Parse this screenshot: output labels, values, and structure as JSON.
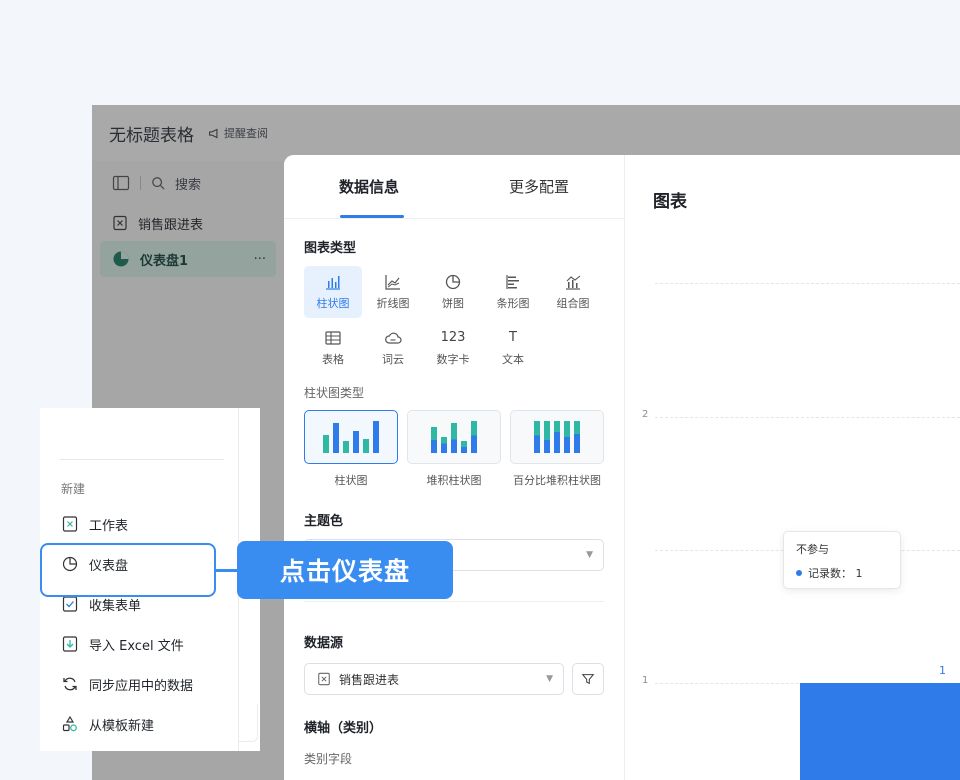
{
  "app": {
    "title": "无标题表格",
    "remind_label": "提醒查阅",
    "search_label": "搜索",
    "nav_items": [
      {
        "label": "销售跟进表",
        "icon": "sheet-icon"
      },
      {
        "label": "仪表盘1",
        "icon": "dashboard-pie-icon",
        "more": "···"
      }
    ]
  },
  "config": {
    "tabs": [
      {
        "label": "数据信息",
        "active": true
      },
      {
        "label": "更多配置",
        "active": false
      }
    ],
    "chart_type_title": "图表类型",
    "chart_types": [
      {
        "label": "柱状图",
        "icon": "bar-chart-icon",
        "active": true
      },
      {
        "label": "折线图",
        "icon": "line-chart-icon"
      },
      {
        "label": "饼图",
        "icon": "pie-chart-icon"
      },
      {
        "label": "条形图",
        "icon": "horizontal-bar-icon"
      },
      {
        "label": "组合图",
        "icon": "combo-chart-icon"
      },
      {
        "label": "表格",
        "icon": "table-icon"
      },
      {
        "label": "词云",
        "icon": "word-cloud-icon"
      },
      {
        "label": "数字卡",
        "icon_text": "123"
      },
      {
        "label": "文本",
        "icon_text": "T"
      }
    ],
    "bar_type_title": "柱状图类型",
    "bar_variants": [
      {
        "label": "柱状图",
        "active": true
      },
      {
        "label": "堆积柱状图"
      },
      {
        "label": "百分比堆积柱状图"
      }
    ],
    "theme_title": "主题色",
    "datasource_title": "数据源",
    "datasource_value": "销售跟进表",
    "axis_title": "横轴（类别）",
    "axis_sub": "类别字段"
  },
  "chart": {
    "title": "图表",
    "accent": "#2f7bea",
    "tick_top": "2",
    "tick_bottom": "1",
    "bar_value_label": "1",
    "tooltip_title": "不参与",
    "tooltip_row": "记录数： 1"
  },
  "new_menu": {
    "heading": "新建",
    "items": [
      {
        "label": "工作表",
        "icon": "worksheet-icon"
      },
      {
        "label": "仪表盘",
        "icon": "dashboard-icon",
        "highlighted": true
      },
      {
        "label": "收集表单",
        "icon": "form-icon"
      },
      {
        "label": "导入 Excel 文件",
        "icon": "import-icon"
      },
      {
        "label": "同步应用中的数据",
        "icon": "sync-icon"
      },
      {
        "label": "从模板新建",
        "icon": "template-icon"
      }
    ]
  },
  "callout": {
    "text": "点击仪表盘",
    "color": "#3a8df0"
  }
}
